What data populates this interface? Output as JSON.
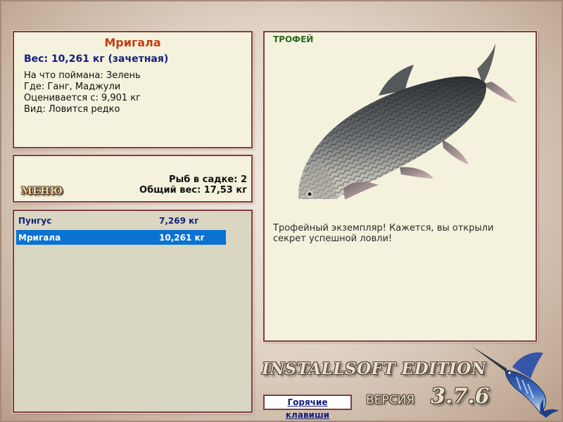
{
  "fish_info": {
    "name": "Мригала",
    "weight_line": "Вес: 10,261 кг (зачетная)",
    "bait": "На что поймана: Зелень",
    "location": "Где: Ганг, Маджули",
    "valued_from": "Оценивается с: 9,901 кг",
    "rarity": "Вид: Ловится редко"
  },
  "summary": {
    "menu_label": "МЕНЮ",
    "fish_in_keepnet": "Рыб в садке: 2",
    "total_weight": "Общий вес: 17,53 кг"
  },
  "catch_list": [
    {
      "name": "Пунгус",
      "weight": "7,269 кг",
      "selected": false
    },
    {
      "name": "Мригала",
      "weight": "10,261 кг",
      "selected": true
    }
  ],
  "trophy": {
    "label": "ТРОФЕЙ",
    "message": "Трофейный экземпляр! Кажется, вы открыли секрет успешной ловли!"
  },
  "footer": {
    "edition": "INSTALLSOFT EDITION",
    "hotkeys_label": "Горячие клавиши",
    "version_label": "ВЕРСИЯ",
    "version_number": "3.7.6"
  },
  "icons": {
    "fish_image": "mrigal-fish-image",
    "logo": "marlin-logo-icon"
  },
  "colors": {
    "panel_border": "#7e3f44",
    "panel_bg": "#f4f1dd",
    "title_red": "#c43d12",
    "text_blue": "#14207e",
    "selection_blue": "#0a72d2",
    "trophy_green": "#2b6b1f"
  }
}
